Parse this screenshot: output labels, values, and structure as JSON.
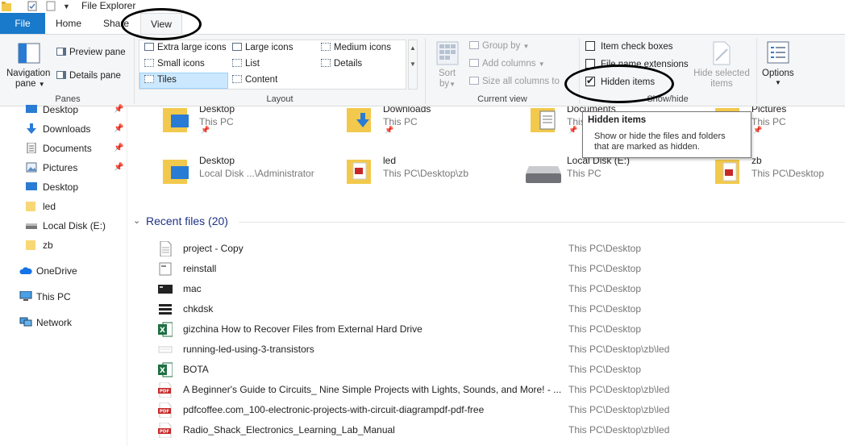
{
  "window": {
    "title": "File Explorer"
  },
  "tabs": [
    {
      "label": "File"
    },
    {
      "label": "Home"
    },
    {
      "label": "Share"
    },
    {
      "label": "View"
    }
  ],
  "ribbon": {
    "panes": {
      "group_label": "Panes",
      "navigation_pane": "Navigation",
      "navigation_pane_2": "pane",
      "preview_pane": "Preview pane",
      "details_pane": "Details pane"
    },
    "layout": {
      "group_label": "Layout",
      "options": {
        "extra_large": "Extra large icons",
        "large": "Large icons",
        "medium": "Medium icons",
        "small": "Small icons",
        "list": "List",
        "details": "Details",
        "tiles": "Tiles",
        "content": "Content"
      },
      "selected": "Tiles"
    },
    "current_view": {
      "group_label": "Current view",
      "sort_by": "Sort",
      "sort_by_2": "by",
      "group_by": "Group by",
      "add_columns": "Add columns",
      "size_columns": "Size all columns to fit"
    },
    "show_hide": {
      "group_label": "Show/hide",
      "item_check_boxes": "Item check boxes",
      "file_name_extensions": "File name extensions",
      "hidden_items": "Hidden items",
      "hidden_items_checked": true,
      "hide_selected": "Hide selected",
      "hide_selected_2": "items"
    },
    "options": {
      "label": "Options"
    }
  },
  "tooltip": {
    "title": "Hidden items",
    "body_line1": "Show or hide the files and folders",
    "body_line2": "that are marked as hidden."
  },
  "sidebar": {
    "items": [
      {
        "label": "Desktop",
        "icon": "desktop-icon",
        "pinned": true
      },
      {
        "label": "Downloads",
        "icon": "download-icon",
        "pinned": true
      },
      {
        "label": "Documents",
        "icon": "documents-icon",
        "pinned": true
      },
      {
        "label": "Pictures",
        "icon": "pictures-icon",
        "pinned": true
      },
      {
        "label": "Desktop",
        "icon": "desktop-icon",
        "pinned": false
      },
      {
        "label": "led",
        "icon": "folder-icon",
        "pinned": false
      },
      {
        "label": "Local Disk (E:)",
        "icon": "drive-icon",
        "pinned": false
      },
      {
        "label": "zb",
        "icon": "folder-icon",
        "pinned": false
      },
      {
        "label": "OneDrive",
        "icon": "cloud-icon",
        "pinned": false
      },
      {
        "label": "This PC",
        "icon": "pc-icon",
        "pinned": false
      },
      {
        "label": "Network",
        "icon": "network-icon",
        "pinned": false
      }
    ]
  },
  "quick_access": [
    {
      "name": "Desktop",
      "sub": "This PC",
      "pinned": true,
      "icon": "desktop-folder-icon"
    },
    {
      "name": "Downloads",
      "sub": "This PC",
      "pinned": true,
      "icon": "downloads-folder-icon"
    },
    {
      "name": "Documents",
      "sub": "This PC",
      "pinned": true,
      "icon": "documents-folder-icon"
    },
    {
      "name": "Pictures",
      "sub": "This PC",
      "pinned": true,
      "icon": "pictures-folder-icon"
    },
    {
      "name": "Desktop",
      "sub": "Local Disk ...\\Administrator",
      "pinned": false,
      "icon": "desktop-folder-icon"
    },
    {
      "name": "led",
      "sub": "This PC\\Desktop\\zb",
      "pinned": false,
      "icon": "pdf-folder-icon"
    },
    {
      "name": "Local Disk (E:)",
      "sub": "This PC",
      "pinned": false,
      "icon": "drive-icon"
    },
    {
      "name": "zb",
      "sub": "This PC\\Desktop",
      "pinned": false,
      "icon": "pdf-folder-icon"
    }
  ],
  "recent": {
    "header": "Recent files (20)",
    "files": [
      {
        "name": "project - Copy",
        "location": "This PC\\Desktop",
        "icon": "text-file-icon"
      },
      {
        "name": "reinstall",
        "location": "This PC\\Desktop",
        "icon": "batch-file-icon"
      },
      {
        "name": "mac",
        "location": "This PC\\Desktop",
        "icon": "terminal-file-icon"
      },
      {
        "name": "chkdsk",
        "location": "This PC\\Desktop",
        "icon": "config-file-icon"
      },
      {
        "name": "gizchina How to Recover Files from External Hard Drive",
        "location": "This PC\\Desktop",
        "icon": "excel-file-icon"
      },
      {
        "name": "running-led-using-3-transistors",
        "location": "This PC\\Desktop\\zb\\led",
        "icon": "image-file-icon"
      },
      {
        "name": "BOTA",
        "location": "This PC\\Desktop",
        "icon": "excel-file-icon"
      },
      {
        "name": "A Beginner's Guide to Circuits_ Nine Simple Projects with Lights, Sounds, and More! - ...",
        "location": "This PC\\Desktop\\zb\\led",
        "icon": "pdf-file-icon"
      },
      {
        "name": "pdfcoffee.com_100-electronic-projects-with-circuit-diagrampdf-pdf-free",
        "location": "This PC\\Desktop\\zb\\led",
        "icon": "pdf-file-icon"
      },
      {
        "name": "Radio_Shack_Electronics_Learning_Lab_Manual",
        "location": "This PC\\Desktop\\zb\\led",
        "icon": "pdf-file-icon"
      }
    ]
  },
  "colors": {
    "file_tab": "#1979ca",
    "folder_yellow": "#f2c94c",
    "link_blue": "#1e3287",
    "selection": "#cce8ff",
    "pdf_red": "#c62828",
    "excel_green": "#1d6f42"
  }
}
